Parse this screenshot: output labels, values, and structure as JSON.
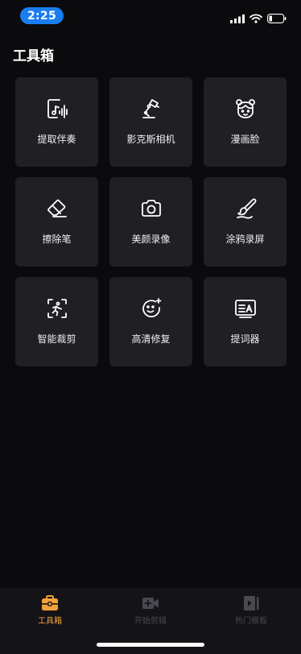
{
  "status_bar": {
    "time": "2:25"
  },
  "page": {
    "title": "工具箱"
  },
  "tools": [
    {
      "label": "提取伴奏",
      "icon": "music-extract-icon"
    },
    {
      "label": "影克斯相机",
      "icon": "desk-lamp-icon"
    },
    {
      "label": "漫画脸",
      "icon": "cartoon-face-icon"
    },
    {
      "label": "擦除笔",
      "icon": "eraser-icon"
    },
    {
      "label": "美颜录像",
      "icon": "camera-icon"
    },
    {
      "label": "涂鸦录屏",
      "icon": "brush-icon"
    },
    {
      "label": "智能裁剪",
      "icon": "smart-crop-icon"
    },
    {
      "label": "高清修复",
      "icon": "face-sparkle-icon"
    },
    {
      "label": "提词器",
      "icon": "teleprompter-icon"
    }
  ],
  "tab_bar": {
    "tabs": [
      {
        "label": "工具箱",
        "icon": "toolbox-icon",
        "active": true
      },
      {
        "label": "开始剪辑",
        "icon": "video-add-icon",
        "active": false
      },
      {
        "label": "热门模板",
        "icon": "template-icon",
        "active": false
      }
    ],
    "active_color": "#f2a23a",
    "inactive_color": "#4a4950"
  },
  "colors": {
    "background": "#0b0a0d",
    "tile": "#1f1f24",
    "time_pill": "#1a7df0"
  }
}
